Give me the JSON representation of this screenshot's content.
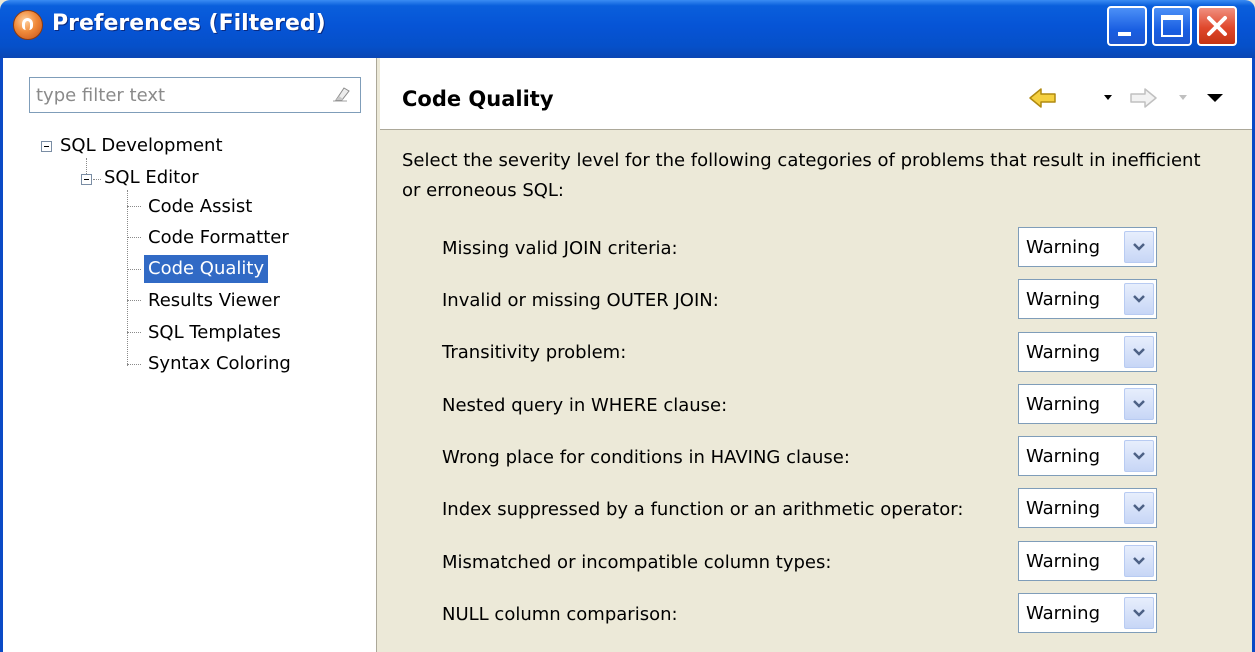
{
  "window": {
    "title": "Preferences (Filtered)",
    "icon": "eclipse-app-icon",
    "controls": [
      "minimize-icon",
      "maximize-icon",
      "close-icon"
    ]
  },
  "filter": {
    "placeholder": "type filter text",
    "value": ""
  },
  "tree": {
    "root": {
      "label": "SQL Development",
      "expanded": true
    },
    "child": {
      "label": "SQL Editor",
      "expanded": true
    },
    "leaves": [
      {
        "label": "Code Assist",
        "selected": false
      },
      {
        "label": "Code Formatter",
        "selected": false
      },
      {
        "label": "Code Quality",
        "selected": true
      },
      {
        "label": "Results Viewer",
        "selected": false
      },
      {
        "label": "SQL Templates",
        "selected": false
      },
      {
        "label": "Syntax Coloring",
        "selected": false
      }
    ]
  },
  "page": {
    "title": "Code Quality",
    "description": "Select the severity level for the following categories of problems that result in inefficient or erroneous SQL:",
    "rows": [
      {
        "label": "Missing valid JOIN criteria:",
        "value": "Warning"
      },
      {
        "label": "Invalid or missing OUTER JOIN:",
        "value": "Warning"
      },
      {
        "label": "Transitivity problem:",
        "value": "Warning"
      },
      {
        "label": "Nested query in WHERE clause:",
        "value": "Warning"
      },
      {
        "label": "Wrong place for conditions in HAVING clause:",
        "value": "Warning"
      },
      {
        "label": "Index suppressed by a function or an arithmetic operator:",
        "value": "Warning"
      },
      {
        "label": "Mismatched or incompatible column types:",
        "value": "Warning"
      },
      {
        "label": "NULL column comparison:",
        "value": "Warning"
      }
    ]
  },
  "colors": {
    "titlebar": "#0654d6",
    "selection": "#316ac5",
    "panel": "#ece9d8",
    "back_arrow": "#f0c020"
  }
}
